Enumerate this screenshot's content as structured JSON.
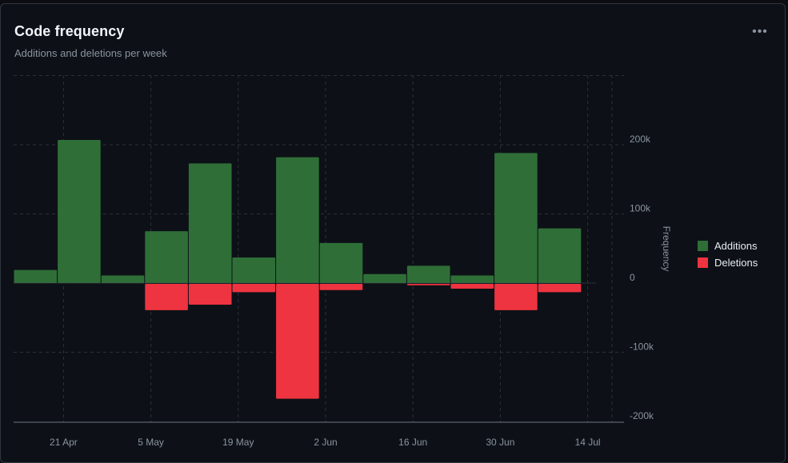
{
  "card": {
    "title": "Code frequency",
    "subtitle": "Additions and deletions per week",
    "menu_icon": "kebab-horizontal-icon"
  },
  "colors": {
    "additions": "#2f6f37",
    "deletions": "#ee3440",
    "grid": "#2b3039",
    "axis_text": "#8b949e",
    "baseline": "#484f58"
  },
  "legend": {
    "position": "right",
    "items": [
      {
        "label": "Additions",
        "color": "#2f6f37"
      },
      {
        "label": "Deletions",
        "color": "#ee3440"
      }
    ]
  },
  "chart_data": {
    "type": "bar",
    "title": "Code frequency",
    "subtitle": "Additions and deletions per week",
    "ylabel": "Frequency",
    "ylim": [
      -200000,
      200000
    ],
    "yticks": [
      {
        "value": 200000,
        "label": "200k"
      },
      {
        "value": 100000,
        "label": "100k"
      },
      {
        "value": 0,
        "label": "0"
      },
      {
        "value": -100000,
        "label": "-100k"
      },
      {
        "value": -200000,
        "label": "-200k"
      }
    ],
    "xticks": [
      "21 Apr",
      "5 May",
      "19 May",
      "2 Jun",
      "16 Jun",
      "30 Jun",
      "14 Jul"
    ],
    "weeks": [
      "2025-04-13",
      "2025-04-20",
      "2025-04-27",
      "2025-05-04",
      "2025-05-11",
      "2025-05-18",
      "2025-05-25",
      "2025-06-01",
      "2025-06-08",
      "2025-06-15",
      "2025-06-22",
      "2025-06-29",
      "2025-07-06"
    ],
    "grid": true,
    "series": [
      {
        "name": "Additions",
        "values": [
          19000,
          207000,
          11000,
          75000,
          173000,
          37000,
          182000,
          58000,
          13000,
          25000,
          11000,
          188000,
          79000
        ]
      },
      {
        "name": "Deletions",
        "values": [
          0,
          0,
          0,
          -38000,
          -30000,
          -12000,
          -166000,
          -9000,
          0,
          -2000,
          -7000,
          -38000,
          -12000
        ]
      }
    ]
  }
}
